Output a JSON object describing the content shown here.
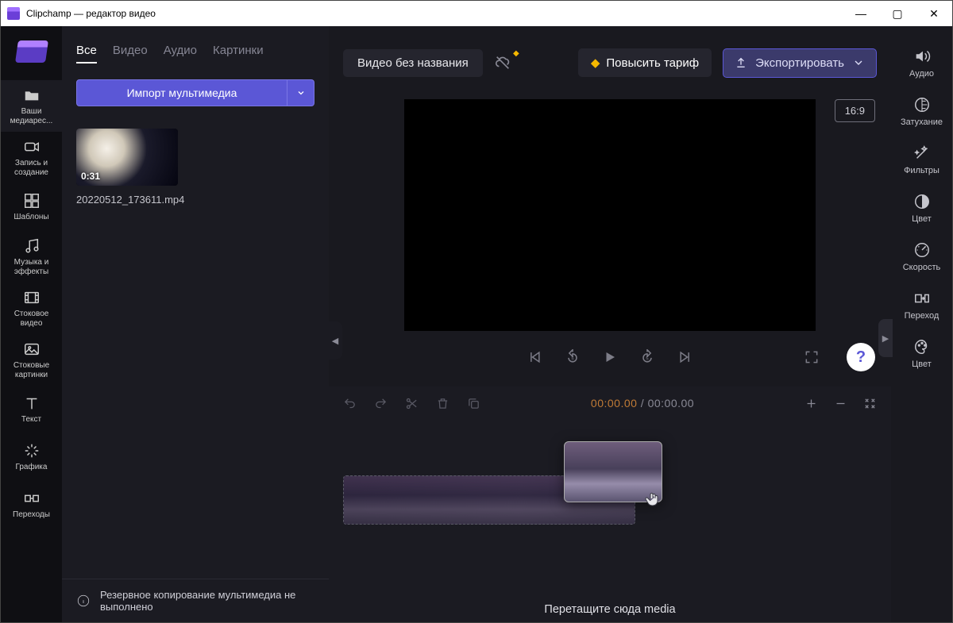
{
  "window": {
    "title": "Clipchamp — редактор видео"
  },
  "sidebar": {
    "items": [
      {
        "label": "Ваши медиарес..."
      },
      {
        "label": "Запись и создание"
      },
      {
        "label": "Шаблоны"
      },
      {
        "label": "Музыка и эффекты"
      },
      {
        "label": "Стоковое видео"
      },
      {
        "label": "Стоковые картинки"
      },
      {
        "label": "Текст"
      },
      {
        "label": "Графика"
      },
      {
        "label": "Переходы"
      }
    ]
  },
  "mediaPanel": {
    "tabs": [
      {
        "label": "Все",
        "active": true
      },
      {
        "label": "Видео"
      },
      {
        "label": "Аудио"
      },
      {
        "label": "Картинки"
      }
    ],
    "importLabel": "Импорт мультимедиа",
    "clip": {
      "duration": "0:31",
      "filename": "20220512_173611.mp4"
    },
    "backupMsg": "Резервное копирование мультимедиа не выполнено"
  },
  "topbar": {
    "projectTitle": "Видео без названия",
    "upgradeLabel": "Повысить тариф",
    "exportLabel": "Экспортировать"
  },
  "preview": {
    "aspectRatio": "16:9"
  },
  "timeline": {
    "currentTime": "00:00.00",
    "totalTime": "00:00.00",
    "dropHint": "Перетащите сюда media"
  },
  "rightbar": {
    "items": [
      {
        "label": "Аудио"
      },
      {
        "label": "Затухание"
      },
      {
        "label": "Фильтры"
      },
      {
        "label": "Цвет"
      },
      {
        "label": "Скорость"
      },
      {
        "label": "Переход"
      },
      {
        "label": "Цвет"
      }
    ]
  }
}
